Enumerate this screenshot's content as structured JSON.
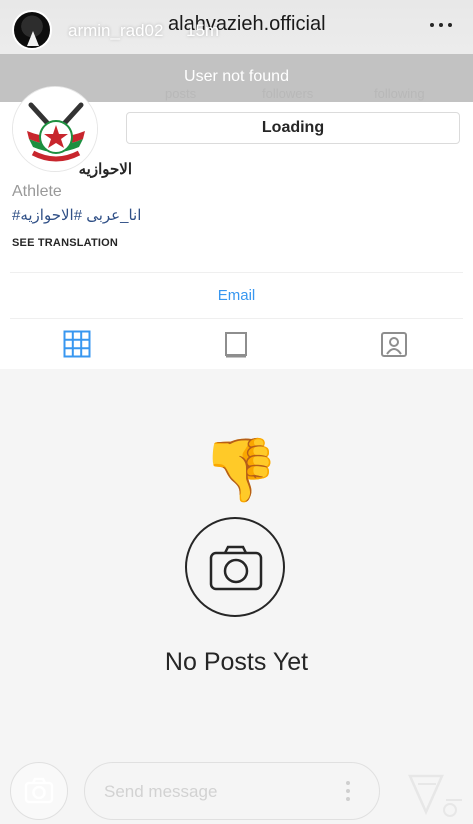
{
  "story_header": {
    "username": "armin_rad02",
    "time": "15m",
    "profile_handle": "alahvazieh.official"
  },
  "banner": {
    "text": "User not found",
    "ghost_stats": [
      "posts",
      "followers",
      "following"
    ]
  },
  "profile": {
    "action_button": "Loading",
    "name": "الاحوازيه",
    "category": "Athlete",
    "hashtags": "#انا_عربی #الاحوازیه",
    "see_translation": "SEE TRANSLATION",
    "email_label": "Email"
  },
  "tabs": [
    {
      "icon": "grid-icon",
      "active": true
    },
    {
      "icon": "igtv-icon",
      "active": false
    },
    {
      "icon": "tagged-icon",
      "active": false
    }
  ],
  "empty_state": {
    "emoji": "👎",
    "message": "No Posts Yet"
  },
  "reply_bar": {
    "placeholder": "Send message"
  },
  "colors": {
    "link": "#3897f0",
    "hashtag": "#2f4f86",
    "banner": "#c2c2c2",
    "text": "#262626"
  }
}
